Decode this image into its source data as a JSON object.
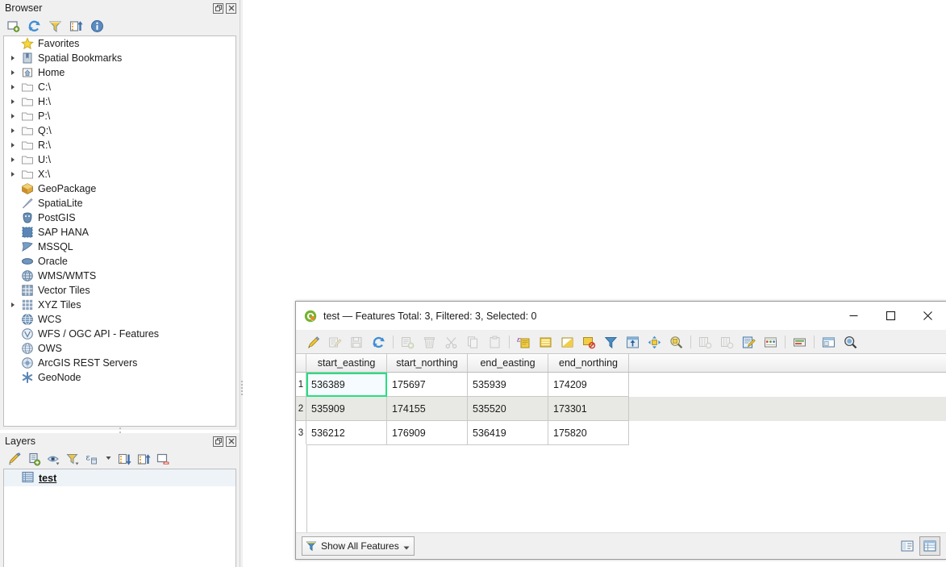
{
  "browser_panel": {
    "title": "Browser",
    "dock_buttons": [
      {
        "name": "float-panel",
        "icon": "float-icon"
      },
      {
        "name": "close-panel",
        "icon": "close-icon"
      }
    ],
    "toolbar": [
      {
        "name": "add-layer-button",
        "icon": "add-layer-icon",
        "tooltip": "Add Selected Layers"
      },
      {
        "name": "refresh-button",
        "icon": "refresh-icon",
        "tooltip": "Refresh"
      },
      {
        "name": "filter-browser-button",
        "icon": "filter-icon",
        "tooltip": "Filter Browser"
      },
      {
        "name": "collapse-all-button",
        "icon": "collapse-all-icon",
        "tooltip": "Collapse All"
      },
      {
        "name": "properties-button",
        "icon": "info-icon",
        "tooltip": "Properties"
      }
    ],
    "items": [
      {
        "label": "Favorites",
        "icon": "star-icon",
        "expandable": false
      },
      {
        "label": "Spatial Bookmarks",
        "icon": "bookmark-icon",
        "expandable": true
      },
      {
        "label": "Home",
        "icon": "home-icon",
        "expandable": true
      },
      {
        "label": "C:\\",
        "icon": "folder-icon",
        "expandable": true
      },
      {
        "label": "H:\\",
        "icon": "folder-icon",
        "expandable": true
      },
      {
        "label": "P:\\",
        "icon": "folder-icon",
        "expandable": true
      },
      {
        "label": "Q:\\",
        "icon": "folder-icon",
        "expandable": true
      },
      {
        "label": "R:\\",
        "icon": "folder-icon",
        "expandable": true
      },
      {
        "label": "U:\\",
        "icon": "folder-icon",
        "expandable": true
      },
      {
        "label": "X:\\",
        "icon": "folder-icon",
        "expandable": true
      },
      {
        "label": "GeoPackage",
        "icon": "geopackage-icon",
        "expandable": false
      },
      {
        "label": "SpatiaLite",
        "icon": "spatialite-icon",
        "expandable": false
      },
      {
        "label": "PostGIS",
        "icon": "postgis-icon",
        "expandable": false
      },
      {
        "label": "SAP HANA",
        "icon": "saphana-icon",
        "expandable": false
      },
      {
        "label": "MSSQL",
        "icon": "mssql-icon",
        "expandable": false
      },
      {
        "label": "Oracle",
        "icon": "oracle-icon",
        "expandable": false
      },
      {
        "label": "WMS/WMTS",
        "icon": "wms-icon",
        "expandable": false
      },
      {
        "label": "Vector Tiles",
        "icon": "vector-tiles-icon",
        "expandable": false
      },
      {
        "label": "XYZ Tiles",
        "icon": "xyz-tiles-icon",
        "expandable": true
      },
      {
        "label": "WCS",
        "icon": "wcs-icon",
        "expandable": false
      },
      {
        "label": "WFS / OGC API - Features",
        "icon": "wfs-icon",
        "expandable": false
      },
      {
        "label": "OWS",
        "icon": "ows-icon",
        "expandable": false
      },
      {
        "label": "ArcGIS REST Servers",
        "icon": "arcgis-icon",
        "expandable": false
      },
      {
        "label": "GeoNode",
        "icon": "geonode-icon",
        "expandable": false
      }
    ]
  },
  "layers_panel": {
    "title": "Layers",
    "dock_buttons": [
      {
        "name": "float-panel",
        "icon": "float-icon"
      },
      {
        "name": "close-panel",
        "icon": "close-icon"
      }
    ],
    "toolbar": [
      {
        "name": "open-layer-styling-button",
        "icon": "style-brush-icon"
      },
      {
        "name": "add-group-button",
        "icon": "add-group-icon"
      },
      {
        "name": "manage-layer-visibility-button",
        "icon": "eye-icon"
      },
      {
        "name": "filter-legend-button",
        "icon": "filter-icon"
      },
      {
        "name": "filter-legend-expression-button",
        "icon": "expression-filter-icon"
      },
      {
        "name": "expand-all-button",
        "icon": "expand-all-icon"
      },
      {
        "name": "collapse-all-button",
        "icon": "collapse-all-icon"
      },
      {
        "name": "remove-layer-button",
        "icon": "remove-layer-icon"
      }
    ],
    "layers": [
      {
        "name": "test",
        "icon": "table-layer-icon",
        "selected": true
      }
    ]
  },
  "attribute_table": {
    "title": "test — Features Total: 3, Filtered: 3, Selected: 0",
    "app_icon": "qgis-icon",
    "window_controls": [
      {
        "name": "minimize-button",
        "icon": "minimize-icon"
      },
      {
        "name": "maximize-button",
        "icon": "maximize-icon"
      },
      {
        "name": "close-button",
        "icon": "close-icon"
      }
    ],
    "toolbar": [
      {
        "name": "toggle-editing-button",
        "icon": "pencil-icon",
        "enabled": true
      },
      {
        "name": "save-edits-button",
        "icon": "multi-edit-icon",
        "enabled": false
      },
      {
        "name": "save-layer-edits-button",
        "icon": "save-icon",
        "enabled": false
      },
      {
        "name": "reload-table-button",
        "icon": "refresh-icon",
        "enabled": true
      },
      {
        "name": "separator",
        "icon": "separator"
      },
      {
        "name": "add-feature-button",
        "icon": "add-feature-icon",
        "enabled": false
      },
      {
        "name": "delete-selected-features-button",
        "icon": "trash-icon",
        "enabled": false
      },
      {
        "name": "cut-features-button",
        "icon": "scissors-icon",
        "enabled": false
      },
      {
        "name": "copy-features-button",
        "icon": "copy-icon",
        "enabled": false
      },
      {
        "name": "paste-features-button",
        "icon": "paste-icon",
        "enabled": false
      },
      {
        "name": "separator",
        "icon": "separator"
      },
      {
        "name": "select-by-expression-button",
        "icon": "select-expression-icon",
        "enabled": true
      },
      {
        "name": "select-all-button",
        "icon": "select-all-icon",
        "enabled": true
      },
      {
        "name": "invert-selection-button",
        "icon": "invert-selection-icon",
        "enabled": true
      },
      {
        "name": "deselect-all-button",
        "icon": "deselect-all-icon",
        "enabled": true
      },
      {
        "name": "filter-select-button",
        "icon": "filter-icon",
        "enabled": true
      },
      {
        "name": "move-selection-to-top-button",
        "icon": "move-top-icon",
        "enabled": true
      },
      {
        "name": "pan-map-to-selected-button",
        "icon": "pan-to-selected-icon",
        "enabled": true
      },
      {
        "name": "zoom-map-to-selected-button",
        "icon": "zoom-to-selected-icon",
        "enabled": true
      },
      {
        "name": "separator",
        "icon": "separator"
      },
      {
        "name": "new-field-button",
        "icon": "new-field-icon",
        "enabled": false
      },
      {
        "name": "delete-field-button",
        "icon": "delete-field-icon",
        "enabled": false
      },
      {
        "name": "open-field-calculator-button",
        "icon": "field-calculator-icon",
        "enabled": true
      },
      {
        "name": "conditional-formatting-button",
        "icon": "conditional-format-icon",
        "enabled": true
      },
      {
        "name": "separator",
        "icon": "separator"
      },
      {
        "name": "actions-button",
        "icon": "actions-icon",
        "enabled": true
      },
      {
        "name": "separator",
        "icon": "separator"
      },
      {
        "name": "dock-undock-button",
        "icon": "dock-icon",
        "enabled": true
      },
      {
        "name": "zoom-to-feature-button",
        "icon": "zoom-feature-icon",
        "enabled": true
      }
    ],
    "columns": [
      "start_easting",
      "start_northing",
      "end_easting",
      "end_northing"
    ],
    "rows": [
      {
        "num": "1",
        "cells": [
          "536389",
          "175697",
          "535939",
          "174209"
        ]
      },
      {
        "num": "2",
        "cells": [
          "535909",
          "174155",
          "535520",
          "173301"
        ]
      },
      {
        "num": "3",
        "cells": [
          "536212",
          "176909",
          "536419",
          "175820"
        ]
      }
    ],
    "selected_cell": {
      "row": 0,
      "col": 0
    },
    "status_bar": {
      "filter_button_label": "Show All Features",
      "filter_button_icon": "filter-icon",
      "view_buttons": [
        {
          "name": "form-view-button",
          "icon": "form-view-icon",
          "active": false
        },
        {
          "name": "table-view-button",
          "icon": "table-view-icon",
          "active": true
        }
      ]
    }
  },
  "colors": {
    "panel_bg": "#f0f0f0",
    "canvas_bg": "#ffffff",
    "selection_green": "#24e07f",
    "row_alt": "#e8e8e4",
    "layer_highlight": "#eef3f8",
    "qgis_green": "#74b230"
  }
}
